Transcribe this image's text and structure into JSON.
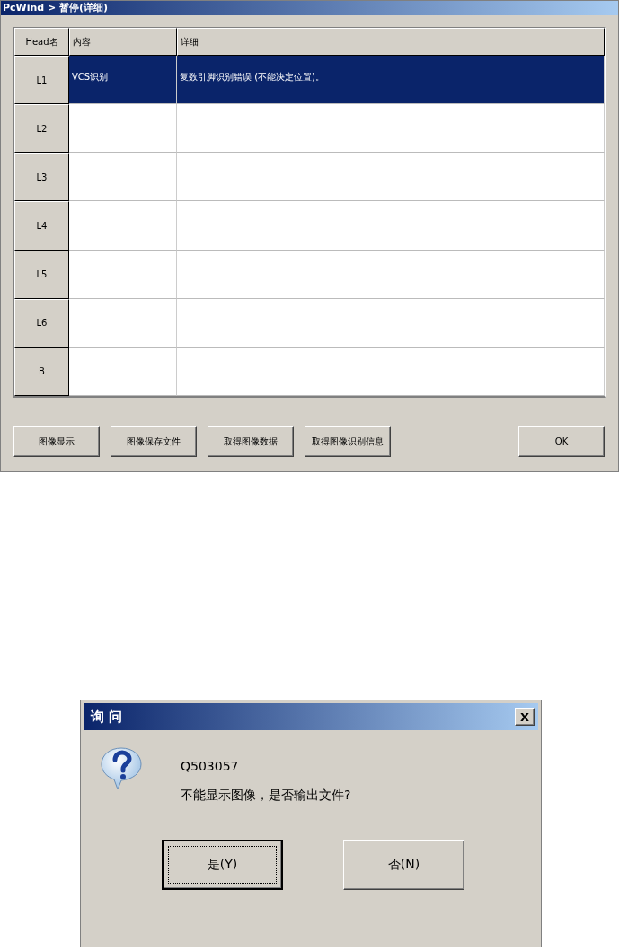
{
  "window": {
    "title": "PcWind > 暂停(详细)"
  },
  "table": {
    "columns": [
      "Head名",
      "内容",
      "详细"
    ],
    "rows": [
      {
        "head": "L1",
        "content": "VCS识别",
        "detail": "复数引脚识别错误 (不能决定位置)。",
        "selected": true
      },
      {
        "head": "L2",
        "selected": false
      },
      {
        "head": "L3",
        "selected": false
      },
      {
        "head": "L4",
        "selected": false
      },
      {
        "head": "L5",
        "selected": false
      },
      {
        "head": "L6",
        "selected": false
      },
      {
        "head": "B",
        "selected": false
      }
    ]
  },
  "buttons": [
    "图像显示",
    "图像保存文件",
    "取得图像数据",
    "取得图像识别信息",
    "OK"
  ],
  "dialog": {
    "title": "询 问",
    "close": "X",
    "code": "Q503057",
    "message": "不能显示图像，是否输出文件?",
    "buttons": [
      {
        "label": "是(Y)",
        "default": true
      },
      {
        "label": "否(N)",
        "default": false
      }
    ]
  }
}
